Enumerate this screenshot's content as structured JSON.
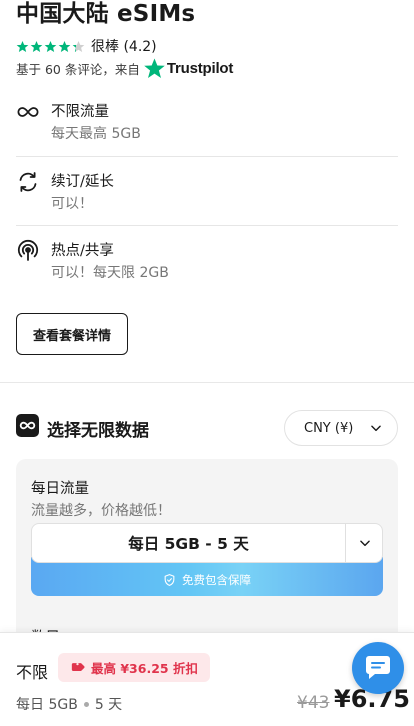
{
  "header": {
    "title": "中国大陆 eSIMs",
    "rating_text": "很棒 (4.2)",
    "rating_stars": 4.2,
    "reviews_text": "基于 60 条评论，来自",
    "trustpilot_label": "Trustpilot",
    "trustpilot_color": "#00b67a"
  },
  "features": [
    {
      "icon": "infinity-icon",
      "title": "不限流量",
      "subtitle": "每天最高 5GB"
    },
    {
      "icon": "refresh-icon",
      "title": "续订/延长",
      "subtitle": "可以！"
    },
    {
      "icon": "hotspot-icon",
      "title": "热点/共享",
      "subtitle": "可以！每天限 2GB"
    }
  ],
  "details_button": "查看套餐详情",
  "select_section": {
    "title": "选择无限数据",
    "currency": "CNY (¥)"
  },
  "plan_card": {
    "title": "每日流量",
    "subtitle": "流量越多，价格越低！",
    "selected_plan": "每日 5GB - 5 天",
    "protection_text": "免费包含保障",
    "next_label": "数目"
  },
  "bottom_bar": {
    "name": "不限",
    "discount": "最高 ¥36.25 折扣",
    "plan_size": "每日 5GB",
    "plan_days": "5 天",
    "old_price": "¥43",
    "new_price": "¥6.75"
  },
  "colors": {
    "star_green": "#00b67a",
    "discount_red": "#e0344c",
    "chat_blue": "#2f8fe8"
  }
}
